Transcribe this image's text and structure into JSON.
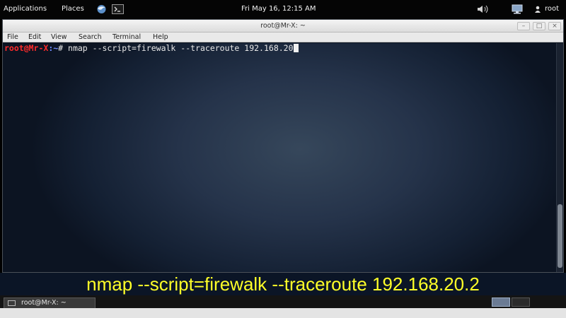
{
  "top_panel": {
    "applications_label": "Applications",
    "places_label": "Places",
    "clock": "Fri May 16, 12:15 AM",
    "user_label": "root"
  },
  "window": {
    "title": "root@Mr-X: ~",
    "menu": [
      "File",
      "Edit",
      "View",
      "Search",
      "Terminal",
      "Help"
    ],
    "buttons": {
      "minimize": "–",
      "maximize": "□",
      "close": "×"
    }
  },
  "terminal": {
    "prompt_user": "root@Mr-X",
    "prompt_path": ":~",
    "prompt_symbol": "#",
    "command": " nmap --script=firewalk --traceroute 192.168.20"
  },
  "caption": "nmap --script=firewalk --traceroute 192.168.20.2",
  "taskbar": {
    "task_label": "root@Mr-X: ~"
  },
  "colors": {
    "caption": "#ffff28",
    "prompt_user": "#ff2b2b",
    "prompt_path": "#6f8bff"
  },
  "icons": [
    "iceweasel-icon",
    "terminal-launcher-icon",
    "volume-icon",
    "network-icon",
    "user-icon",
    "terminal-task-icon"
  ]
}
